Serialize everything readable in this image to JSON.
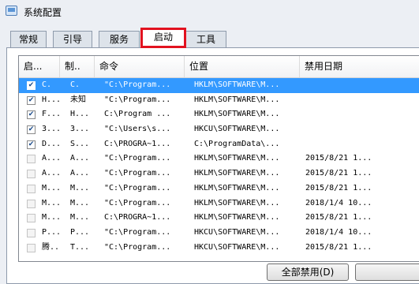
{
  "window": {
    "title": "系统配置"
  },
  "tabs": [
    {
      "label": "常规"
    },
    {
      "label": "引导"
    },
    {
      "label": "服务"
    },
    {
      "label": "启动"
    },
    {
      "label": "工具"
    }
  ],
  "active_tab": "启动",
  "columns": [
    "启...",
    "制..",
    "命令",
    "位置",
    "禁用日期"
  ],
  "rows": [
    {
      "checked": true,
      "selected": true,
      "item": "C.",
      "maker": "C.",
      "command": "\"C:\\Program...",
      "location": "HKLM\\SOFTWARE\\M...",
      "disabled_date": ""
    },
    {
      "checked": true,
      "selected": false,
      "item": "H...",
      "maker": "未知",
      "command": "\"C:\\Program...",
      "location": "HKLM\\SOFTWARE\\M...",
      "disabled_date": ""
    },
    {
      "checked": true,
      "selected": false,
      "item": "F...",
      "maker": "H...",
      "command": "C:\\Program ...",
      "location": "HKLM\\SOFTWARE\\M...",
      "disabled_date": ""
    },
    {
      "checked": true,
      "selected": false,
      "item": "3...",
      "maker": "3...",
      "command": "\"C:\\Users\\s...",
      "location": "HKCU\\SOFTWARE\\M...",
      "disabled_date": ""
    },
    {
      "checked": true,
      "selected": false,
      "item": "D...",
      "maker": "S...",
      "command": "C:\\PROGRA~1...",
      "location": "C:\\ProgramData\\...",
      "disabled_date": ""
    },
    {
      "checked": false,
      "selected": false,
      "item": "A...",
      "maker": "A...",
      "command": "\"C:\\Program...",
      "location": "HKLM\\SOFTWARE\\M...",
      "disabled_date": "2015/8/21 1..."
    },
    {
      "checked": false,
      "selected": false,
      "item": "A...",
      "maker": "A...",
      "command": "\"C:\\Program...",
      "location": "HKLM\\SOFTWARE\\M...",
      "disabled_date": "2015/8/21 1..."
    },
    {
      "checked": false,
      "selected": false,
      "item": "M...",
      "maker": "M...",
      "command": "\"C:\\Program...",
      "location": "HKLM\\SOFTWARE\\M...",
      "disabled_date": "2015/8/21 1..."
    },
    {
      "checked": false,
      "selected": false,
      "item": "M...",
      "maker": "M...",
      "command": "\"C:\\Program...",
      "location": "HKLM\\SOFTWARE\\M...",
      "disabled_date": "2018/1/4 10..."
    },
    {
      "checked": false,
      "selected": false,
      "item": "M...",
      "maker": "M...",
      "command": "C:\\PROGRA~1...",
      "location": "HKLM\\SOFTWARE\\M...",
      "disabled_date": "2015/8/21 1..."
    },
    {
      "checked": false,
      "selected": false,
      "item": "P...",
      "maker": "P...",
      "command": "\"C:\\Program...",
      "location": "HKCU\\SOFTWARE\\M...",
      "disabled_date": "2018/1/4 10..."
    },
    {
      "checked": false,
      "selected": false,
      "item": "腾...",
      "maker": "T...",
      "command": "\"C:\\Program...",
      "location": "HKCU\\SOFTWARE\\M...",
      "disabled_date": "2015/8/21 1..."
    }
  ],
  "buttons": {
    "disable_all": "全部禁用(D)"
  },
  "colors": {
    "selection": "#3399ff",
    "highlight_box": "#e2121f"
  },
  "icons": {
    "app": "system-config-icon",
    "check": "checkmark-icon"
  }
}
